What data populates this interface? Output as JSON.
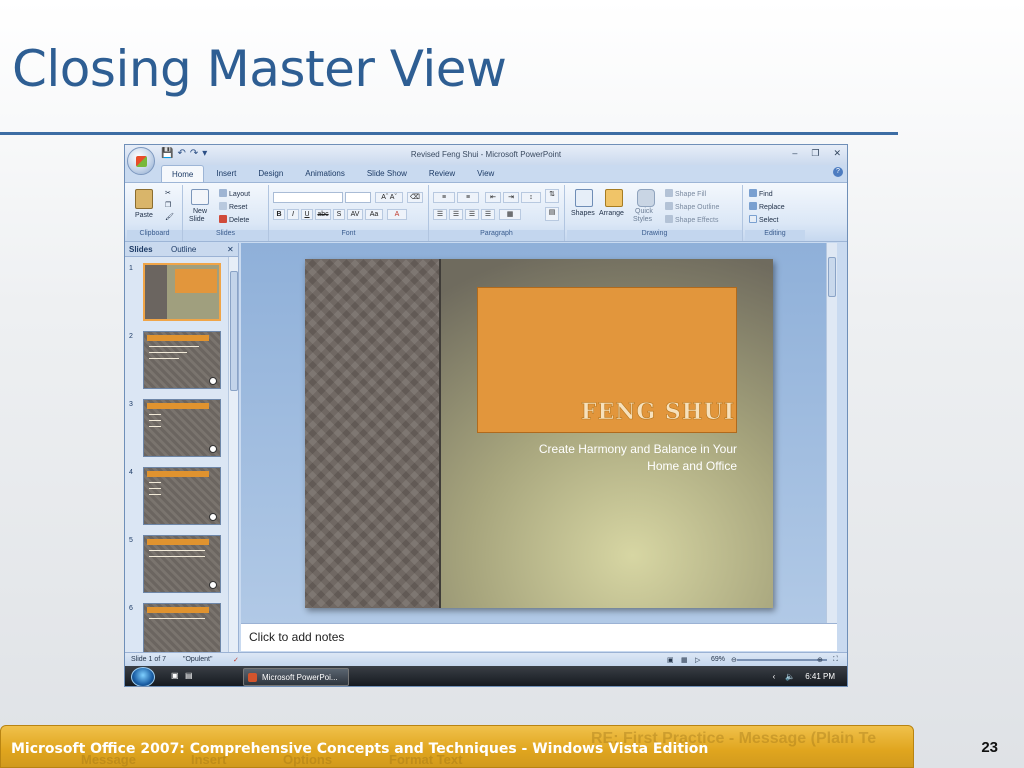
{
  "slide": {
    "title": "Closing Master View",
    "footer": "Microsoft Office 2007: Comprehensive Concepts and Techniques - Windows Vista Edition",
    "page_number": "23",
    "background_ghost": {
      "subject": "RE: First Practice - Message (Plain Te",
      "tabs": [
        "Message",
        "Insert",
        "Options",
        "Format Text"
      ]
    }
  },
  "app": {
    "window_title": "Revised Feng Shui - Microsoft PowerPoint",
    "tabs": [
      "Home",
      "Insert",
      "Design",
      "Animations",
      "Slide Show",
      "Review",
      "View"
    ],
    "active_tab": "Home",
    "ribbon": {
      "clipboard": {
        "label": "Clipboard",
        "paste": "Paste"
      },
      "slides": {
        "label": "Slides",
        "new_slide_1": "New",
        "new_slide_2": "Slide",
        "layout": "Layout",
        "reset": "Reset",
        "delete": "Delete"
      },
      "font": {
        "label": "Font",
        "bold": "B",
        "italic": "I",
        "underline": "U",
        "strike": "abc",
        "shadow": "S",
        "spacing": "AV",
        "case": "Aa"
      },
      "paragraph": {
        "label": "Paragraph"
      },
      "drawing": {
        "label": "Drawing",
        "shapes": "Shapes",
        "arrange": "Arrange",
        "quick_styles_1": "Quick",
        "quick_styles_2": "Styles",
        "shape_fill": "Shape Fill",
        "shape_outline": "Shape Outline",
        "shape_effects": "Shape Effects"
      },
      "editing": {
        "label": "Editing",
        "find": "Find",
        "replace": "Replace",
        "select": "Select"
      }
    },
    "pane_tabs": {
      "slides": "Slides",
      "outline": "Outline"
    },
    "thumbnails": [
      "1",
      "2",
      "3",
      "4",
      "5",
      "6"
    ],
    "current_slide": {
      "heading": "FENG SHUI",
      "subtitle_line1": "Create Harmony and Balance in Your",
      "subtitle_line2": "Home and Office"
    },
    "notes_placeholder": "Click to add notes",
    "status": {
      "slide_info": "Slide 1 of 7",
      "theme": "\"Opulent\"",
      "zoom": "69%"
    },
    "taskbar": {
      "app_button": "Microsoft PowerPoi...",
      "time": "6:41 PM"
    }
  },
  "colors": {
    "title": "#2e5e93",
    "footer_bar": "#e0a51e",
    "slide_orange": "#e2963c"
  }
}
